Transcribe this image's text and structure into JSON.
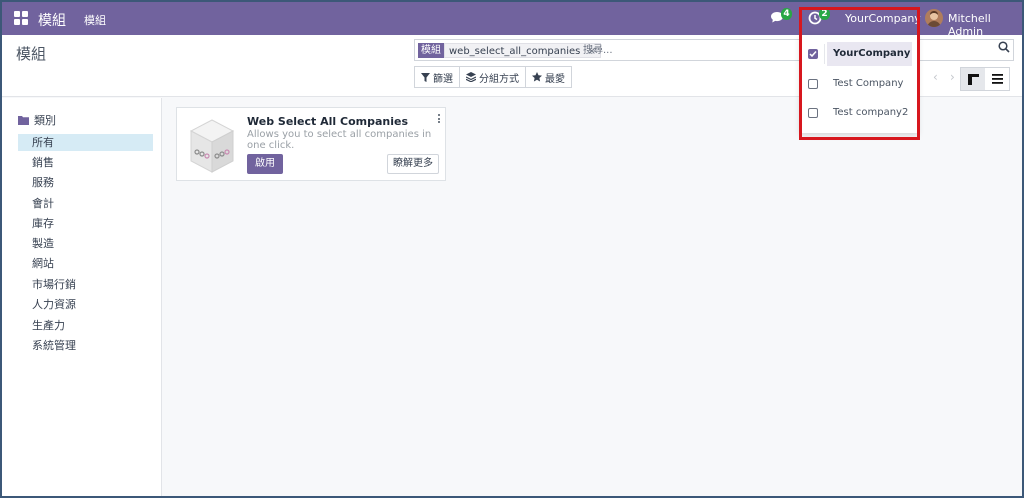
{
  "navbar": {
    "brand": "模組",
    "menu_item": "模組",
    "chat_count": "4",
    "activity_count": "2",
    "company": "YourCompany",
    "user": "Mitchell Admin",
    "color": "#71639e"
  },
  "control_panel": {
    "title": "模組",
    "search": {
      "facet_label": "模組",
      "facet_value": "web_select_all_companies",
      "facet_close": "×",
      "placeholder": "搜尋..."
    },
    "toolbar": {
      "filter_label": "篩選",
      "group_by_label": "分組方式",
      "favorites_label": "最愛"
    },
    "pager": {
      "prev": "‹",
      "next": "›"
    }
  },
  "sidebar": {
    "heading": "類別",
    "items": [
      {
        "label": "所有",
        "active": true
      },
      {
        "label": "銷售"
      },
      {
        "label": "服務"
      },
      {
        "label": "會計"
      },
      {
        "label": "庫存"
      },
      {
        "label": "製造"
      },
      {
        "label": "網站"
      },
      {
        "label": "市場行銷"
      },
      {
        "label": "人力資源"
      },
      {
        "label": "生產力"
      },
      {
        "label": "系統管理"
      }
    ]
  },
  "module_card": {
    "title": "Web Select All Companies",
    "description": "Allows you to select all companies in one click.",
    "install_label": "啟用",
    "learn_more_label": "瞭解更多"
  },
  "company_dropdown": {
    "items": [
      {
        "label": "YourCompany",
        "checked": true,
        "active": true
      },
      {
        "label": "Test Company",
        "checked": false
      },
      {
        "label": "Test company2",
        "checked": false
      }
    ]
  },
  "icons": {
    "apps": "apps-grid-icon",
    "chat": "chat-icon",
    "activity": "clock-icon",
    "search": "search-icon",
    "filter": "filter-icon",
    "group_by": "layers-icon",
    "favorites": "star-icon",
    "folder": "folder-icon",
    "kanban": "kanban-icon",
    "list": "list-icon",
    "more": "kebab-icon"
  },
  "highlight_color": "#d7171e"
}
